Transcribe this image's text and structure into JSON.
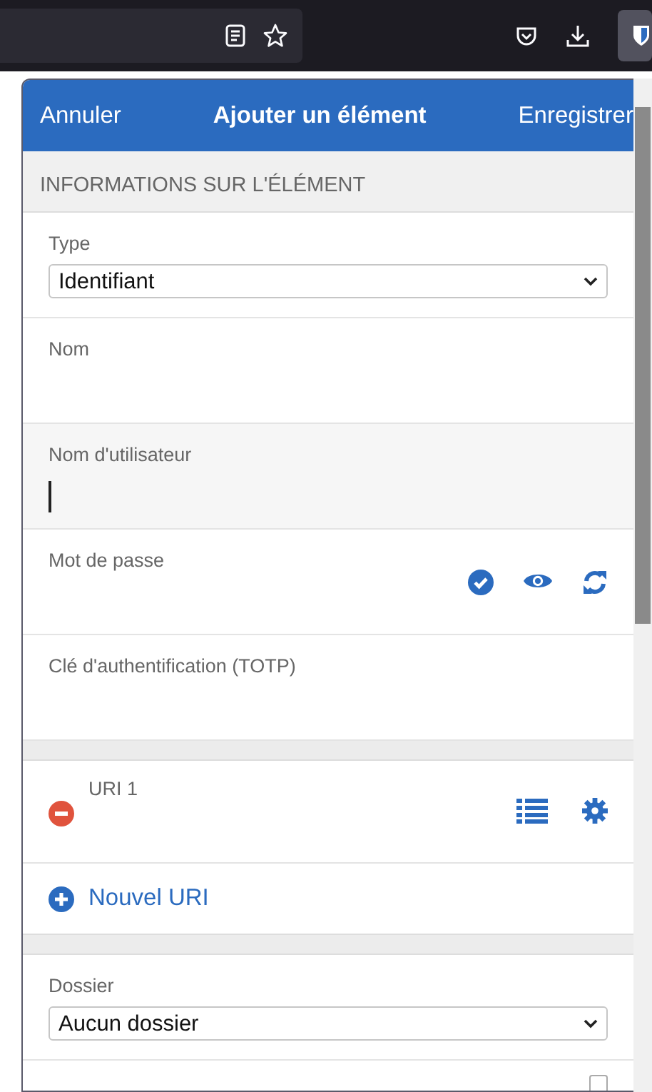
{
  "header": {
    "cancel": "Annuler",
    "title": "Ajouter un élément",
    "save": "Enregistrer"
  },
  "section_title": "INFORMATIONS SUR L'ÉLÉMENT",
  "fields": [
    {
      "kind": "select",
      "label": "Type",
      "value": "Identifiant",
      "focused": false
    },
    {
      "kind": "text",
      "label": "Nom",
      "focused": false
    },
    {
      "kind": "text",
      "label": "Nom d'utilisateur",
      "focused": true
    },
    {
      "kind": "password",
      "label": "Mot de passe",
      "focused": false
    },
    {
      "kind": "text",
      "label": "Clé d'authentification (TOTP)",
      "focused": false
    }
  ],
  "uris": [
    {
      "label": "URI 1"
    }
  ],
  "add_uri": "Nouvel URI",
  "folder": {
    "label": "Dossier",
    "value": "Aucun dossier"
  },
  "favorite": {
    "checked": false
  }
}
